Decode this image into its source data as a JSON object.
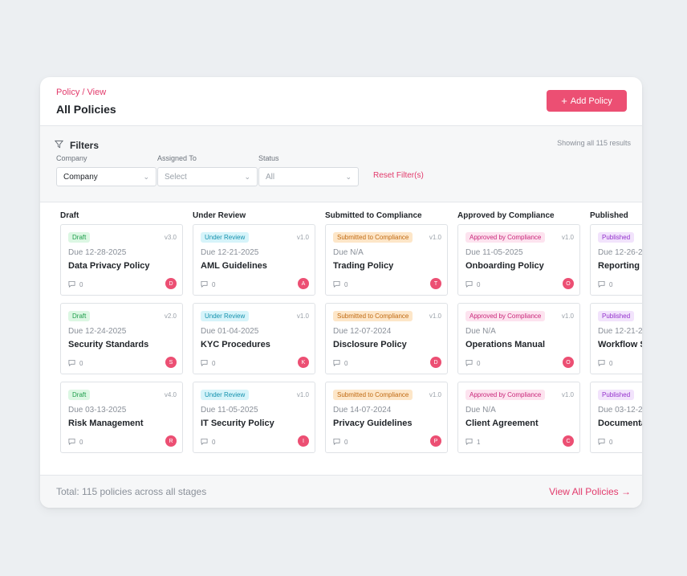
{
  "header": {
    "breadcrumb": "Policy / View",
    "title": "All Policies",
    "add_button": "Add Policy"
  },
  "filters": {
    "title": "Filters",
    "showing": "Showing all 115 results",
    "company": {
      "label": "Company",
      "value": "Company"
    },
    "assigned": {
      "label": "Assigned To",
      "placeholder": "Select"
    },
    "status": {
      "label": "Status",
      "placeholder": "All"
    },
    "reset": "Reset Filter(s)"
  },
  "colors": {
    "accent": "#ec4f73",
    "draft": {
      "bg": "#dcf7e3",
      "fg": "#1f9d4c"
    },
    "review": {
      "bg": "#d6f4fa",
      "fg": "#1491ad"
    },
    "submitted": {
      "bg": "#fde6c8",
      "fg": "#c06a12"
    },
    "approved": {
      "bg": "#fde3ef",
      "fg": "#c9267a"
    },
    "published": {
      "bg": "#f2e3fc",
      "fg": "#9432cc"
    }
  },
  "board": {
    "columns": [
      {
        "title": "Draft",
        "cards": [
          {
            "badge": "Draft",
            "version": "v3.0",
            "due": "Due 12-28-2025",
            "title": "Data Privacy Policy",
            "comments": "0",
            "avatar": "D"
          },
          {
            "badge": "Draft",
            "version": "v2.0",
            "due": "Due 12-24-2025",
            "title": "Security Standards",
            "comments": "0",
            "avatar": "S"
          },
          {
            "badge": "Draft",
            "version": "v4.0",
            "due": "Due 03-13-2025",
            "title": "Risk Management",
            "comments": "0",
            "avatar": "R"
          }
        ]
      },
      {
        "title": "Under Review",
        "cards": [
          {
            "badge": "Under Review",
            "version": "v1.0",
            "due": "Due 12-21-2025",
            "title": "AML Guidelines",
            "comments": "0",
            "avatar": "A"
          },
          {
            "badge": "Under Review",
            "version": "v1.0",
            "due": "Due 01-04-2025",
            "title": "KYC Procedures",
            "comments": "0",
            "avatar": "K"
          },
          {
            "badge": "Under Review",
            "version": "v1.0",
            "due": "Due 11-05-2025",
            "title": "IT Security Policy",
            "comments": "0",
            "avatar": "I"
          }
        ]
      },
      {
        "title": "Submitted to Compliance",
        "cards": [
          {
            "badge": "Submitted to Compliance",
            "version": "v1.0",
            "due": "Due N/A",
            "title": "Trading Policy",
            "comments": "0",
            "avatar": "T"
          },
          {
            "badge": "Submitted to Compliance",
            "version": "v1.0",
            "due": "Due 12-07-2024",
            "title": "Disclosure Policy",
            "comments": "0",
            "avatar": "D"
          },
          {
            "badge": "Submitted to Compliance",
            "version": "v1.0",
            "due": "Due 14-07-2024",
            "title": "Privacy Guidelines",
            "comments": "0",
            "avatar": "P"
          }
        ]
      },
      {
        "title": "Approved by Compliance",
        "cards": [
          {
            "badge": "Approved by Compliance",
            "version": "v1.0",
            "due": "Due 11-05-2025",
            "title": "Onboarding Policy",
            "comments": "0",
            "avatar": "O"
          },
          {
            "badge": "Approved by Compliance",
            "version": "v1.0",
            "due": "Due N/A",
            "title": "Operations Manual",
            "comments": "0",
            "avatar": "O"
          },
          {
            "badge": "Approved by Compliance",
            "version": "v1.0",
            "due": "Due N/A",
            "title": "Client Agreement",
            "comments": "1",
            "avatar": "C"
          }
        ]
      },
      {
        "title": "Published",
        "cards": [
          {
            "badge": "Published",
            "version": "",
            "due": "Due 12-26-2",
            "title": "Reporting",
            "comments": "0",
            "avatar": ""
          },
          {
            "badge": "Published",
            "version": "",
            "due": "Due 12-21-2",
            "title": "Workflow S",
            "comments": "0",
            "avatar": ""
          },
          {
            "badge": "Published",
            "version": "",
            "due": "Due 03-12-2",
            "title": "Documenta",
            "comments": "0",
            "avatar": ""
          }
        ]
      }
    ]
  },
  "footer": {
    "total": "Total: 115 policies across all stages",
    "view_all": "View All Policies →"
  }
}
